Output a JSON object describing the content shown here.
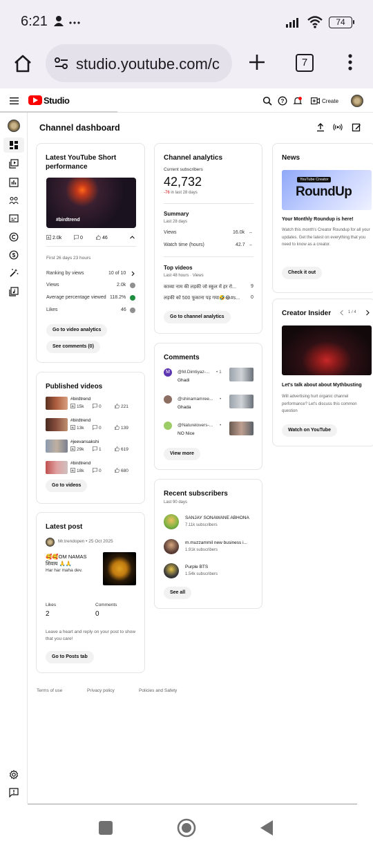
{
  "status": {
    "time": "6:21",
    "left_icons": "person-icon more-icon",
    "battery": "74"
  },
  "browser": {
    "url": "studio.youtube.com/c",
    "tab_count": "7"
  },
  "header": {
    "brand": "Studio",
    "create_label": "Create"
  },
  "page": {
    "title": "Channel dashboard"
  },
  "short_perf": {
    "title": "Latest YouTube Short performance",
    "thumb_caption": "#birdtrend",
    "views": "2.0k",
    "comments": "0",
    "likes": "46",
    "period": "First 26 days 23 hours",
    "rows": [
      {
        "label": "Ranking by views",
        "value": "10 of 10"
      },
      {
        "label": "Views",
        "value": "2.0k"
      },
      {
        "label": "Average percentage viewed",
        "value": "118.2%"
      },
      {
        "label": "Likes",
        "value": "46"
      }
    ],
    "btn_analytics": "Go to video analytics",
    "btn_comments": "See comments (0)"
  },
  "published": {
    "title": "Published videos",
    "items": [
      {
        "title": "#birdtrend",
        "views": "15k",
        "comments": "0",
        "likes": "221"
      },
      {
        "title": "#birdtrend",
        "views": "13k",
        "comments": "0",
        "likes": "139"
      },
      {
        "title": "#jeevansakshi",
        "views": "29k",
        "comments": "1",
        "likes": "619"
      },
      {
        "title": "#birdtrend",
        "views": "18k",
        "comments": "0",
        "likes": "680"
      }
    ],
    "btn": "Go to videos"
  },
  "latest_post": {
    "title": "Latest post",
    "author": "Mr.trendopen",
    "date": "25 Oct 2025",
    "text_line1": "🥰🥰OM NAMAS",
    "text_line2": "शिवाय 🙏🙏",
    "text_line3": "Har har maha dev.",
    "likes_label": "Likes",
    "likes": "2",
    "comments_label": "Comments",
    "comments": "0",
    "hint": "Leave a heart and reply on your post to show that you care!",
    "btn": "Go to Posts tab"
  },
  "analytics": {
    "title": "Channel analytics",
    "subs_label": "Current subscribers",
    "subs": "42,732",
    "subs_delta": "-76",
    "subs_delta_suffix": "in last 28 days",
    "summary_title": "Summary",
    "summary_period": "Last 28 days",
    "rows": [
      {
        "label": "Views",
        "value": "16.0k",
        "trend": "–"
      },
      {
        "label": "Watch time (hours)",
        "value": "42.7",
        "trend": "–"
      }
    ],
    "top_title": "Top videos",
    "top_period": "Last 48 hours",
    "top_col": "Views",
    "top_videos": [
      {
        "title": "काव्या नाम की लड़की जो स्कूल में हर रो...",
        "views": "9"
      },
      {
        "title": "लड़की को 500 फूकाना पड़ गया🤣😂#s...",
        "views": "0"
      }
    ],
    "btn": "Go to channel analytics"
  },
  "comments": {
    "title": "Comments",
    "items": [
      {
        "author": "@M.Dimtiyaz-...",
        "meta": "1",
        "text": "Ghadi"
      },
      {
        "author": "@shinamamree...",
        "meta": "",
        "text": "Ghada"
      },
      {
        "author": "@Naturelovers-...",
        "meta": "",
        "text": "NO Nice"
      }
    ],
    "btn": "View more"
  },
  "recent_subs": {
    "title": "Recent subscribers",
    "period": "Last 90 days",
    "items": [
      {
        "name": "SANJAY SONAWANE ABHONA",
        "subs": "7.11k subscribers"
      },
      {
        "name": "m.muzzammil new business i...",
        "subs": "1.91k subscribers"
      },
      {
        "name": "Purple BTS",
        "subs": "1.54k subscribers"
      }
    ],
    "btn": "See all"
  },
  "news": {
    "title": "News",
    "banner_tag": "YouTube Creator",
    "banner_text": "RoundUp",
    "headline": "Your Monthly Roundup is here!",
    "body": "Watch this month's Creator Roundup for all your updates. Get the latest on everything that you need to know as a creator.",
    "btn": "Check it out"
  },
  "creator_insider": {
    "title": "Creator Insider",
    "pager": "1 / 4",
    "headline": "Let's talk about about Mythbusting",
    "body": "Will advertising hurt organic channel performance? Let's discuss this common question",
    "btn": "Watch on YouTube"
  },
  "footer": {
    "terms": "Terms of use",
    "privacy": "Privacy policy",
    "policies": "Policies and Safety"
  },
  "colors": {
    "accent_red": "#ff0000",
    "green_dot": "#1e8e3e",
    "delta_red": "#cc0000"
  }
}
